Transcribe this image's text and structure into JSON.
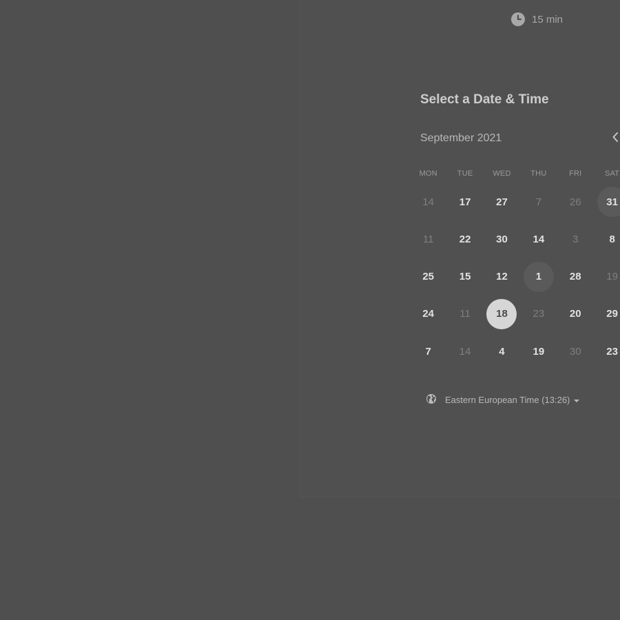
{
  "event": {
    "duration_label": "15 min",
    "duration_icon": "clock-icon"
  },
  "scheduler": {
    "title": "Select a Date & Time",
    "month_label": "September 2021",
    "prev_month_icon": "chevron-left-icon",
    "weekdays": [
      "MON",
      "TUE",
      "WED",
      "THU",
      "FRI",
      "SAT"
    ],
    "weeks": [
      [
        {
          "label": "14",
          "state": "unavailable"
        },
        {
          "label": "17",
          "state": "available"
        },
        {
          "label": "27",
          "state": "available"
        },
        {
          "label": "7",
          "state": "unavailable"
        },
        {
          "label": "26",
          "state": "unavailable"
        },
        {
          "label": "31",
          "state": "highlighted"
        }
      ],
      [
        {
          "label": "11",
          "state": "unavailable"
        },
        {
          "label": "22",
          "state": "available"
        },
        {
          "label": "30",
          "state": "available"
        },
        {
          "label": "14",
          "state": "available"
        },
        {
          "label": "3",
          "state": "unavailable"
        },
        {
          "label": "8",
          "state": "available"
        }
      ],
      [
        {
          "label": "25",
          "state": "available"
        },
        {
          "label": "15",
          "state": "available"
        },
        {
          "label": "12",
          "state": "available"
        },
        {
          "label": "1",
          "state": "highlighted"
        },
        {
          "label": "28",
          "state": "available"
        },
        {
          "label": "19",
          "state": "unavailable"
        }
      ],
      [
        {
          "label": "24",
          "state": "available"
        },
        {
          "label": "11",
          "state": "unavailable"
        },
        {
          "label": "18",
          "state": "selected"
        },
        {
          "label": "23",
          "state": "unavailable"
        },
        {
          "label": "20",
          "state": "available"
        },
        {
          "label": "29",
          "state": "available"
        }
      ],
      [
        {
          "label": "7",
          "state": "available"
        },
        {
          "label": "14",
          "state": "unavailable"
        },
        {
          "label": "4",
          "state": "available"
        },
        {
          "label": "19",
          "state": "available"
        },
        {
          "label": "30",
          "state": "unavailable"
        },
        {
          "label": "23",
          "state": "available"
        }
      ]
    ]
  },
  "timezone": {
    "label": "Eastern European Time (13:26)",
    "icon": "globe-icon"
  },
  "colors": {
    "background": "#4f4f4f",
    "selected_day_bg": "#d6d6d6",
    "highlighted_day_bg": "#5a5a5a",
    "text_primary": "#e2e2e2",
    "text_muted": "#7f7f7f"
  }
}
